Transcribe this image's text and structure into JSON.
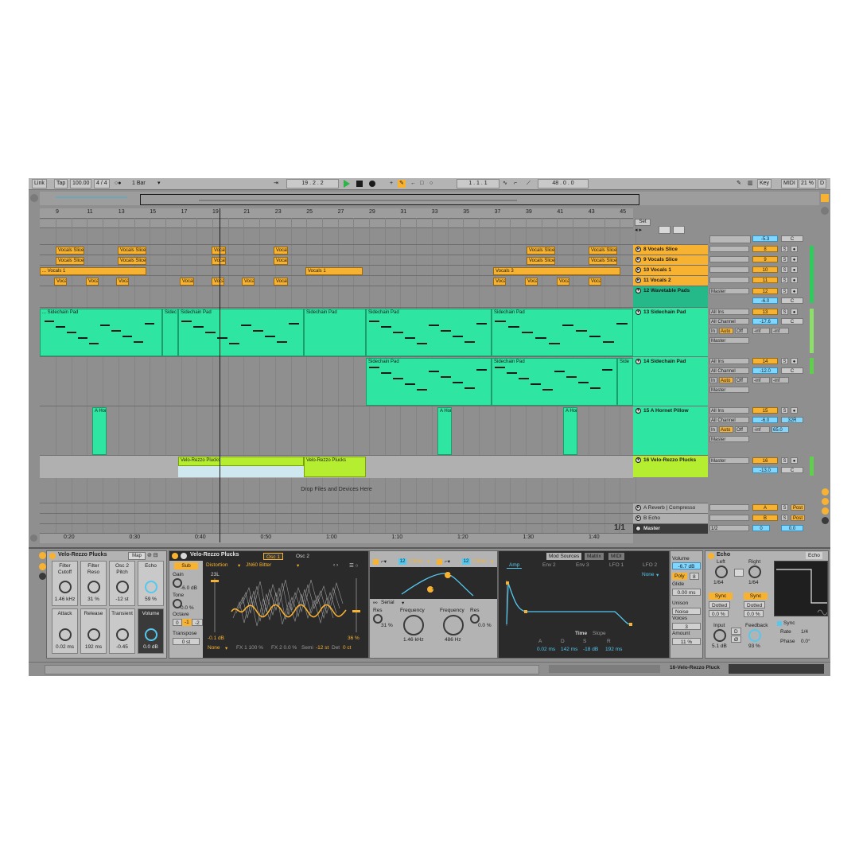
{
  "transport": {
    "link": "Link",
    "tap": "Tap",
    "tempo": "100.00",
    "time_sig": "4 / 4",
    "metronome": "○●",
    "quantize": "1 Bar",
    "position": "19 .  2 .  2",
    "loop_start": "1 .  1 .  1",
    "loop_length": "48 .  0 .  0",
    "key": "Key",
    "midi": "MIDI",
    "cpu": "21 %",
    "d": "D"
  },
  "ruler": [
    "9",
    "11",
    "13",
    "15",
    "17",
    "19",
    "21",
    "23",
    "25",
    "27",
    "29",
    "31",
    "33",
    "35",
    "37",
    "39",
    "41",
    "43",
    "45"
  ],
  "time_ruler": [
    "0:20",
    "0:30",
    "0:40",
    "0:50",
    "1:00",
    "1:10",
    "1:20",
    "1:30",
    "1:40"
  ],
  "set_label": "Set",
  "clips": {
    "vocals_slice": "Vocals Slice",
    "vocal": "Vocal",
    "voca": "Voca",
    "vocals_1_cont": "... Vocals 1",
    "vocals_1": "Vocals 1",
    "vocals_3": "Vocals 3",
    "sidechain_pad": "Sidechain Pad",
    "sidechain_pad_cont": "... Sidechain Pad",
    "sidec": "Sidec",
    "side": "Side",
    "a_hor": "A Hor",
    "velo_rezzo": "Velo-Rezzo Plucks"
  },
  "drop_text": "Drop Files and Devices Here",
  "page_indicator": "1/1",
  "tracks": [
    {
      "name": "8 Vocals Slice",
      "num": "8",
      "color": "#f8b232"
    },
    {
      "name": "9 Vocals Slice",
      "num": "9",
      "color": "#f8b232"
    },
    {
      "name": "10 Vocals 1",
      "num": "10",
      "color": "#f8b232"
    },
    {
      "name": "11 Vocals 2",
      "num": "11",
      "color": "#f8b232"
    },
    {
      "name": "12 Wavetable Pads",
      "num": "12",
      "color": "#2ee6a2",
      "vol": "-6.0",
      "out": "Master"
    },
    {
      "name": "13 Sidechain Pad",
      "num": "13",
      "color": "#2ee6a2",
      "vol": "-17.6",
      "in1": "All Ins",
      "in2": "All Channel",
      "out": "Master"
    },
    {
      "name": "14 Sidechain Pad",
      "num": "14",
      "color": "#2ee6a2",
      "vol": "-12.0",
      "in1": "All Ins",
      "in2": "All Channel",
      "out": "Master"
    },
    {
      "name": "15 A Hornet Pillow",
      "num": "15",
      "color": "#2ee6a2",
      "vol": "-6.0",
      "in1": "All Ins",
      "in2": "All Channel",
      "out": "Master",
      "pan": "32R",
      "send": "65.0"
    },
    {
      "name": "16 Velo-Rezzo Plucks",
      "num": "16",
      "color": "#b5ee30",
      "vol": "-13.0",
      "out": "Master"
    }
  ],
  "top_vol": "-5.3",
  "monitor": {
    "in": "In",
    "auto": "Auto",
    "off": "Off",
    "inf": "-inf"
  },
  "returns": [
    {
      "name": "A Reverb | Compresso",
      "letter": "A",
      "post": "Post"
    },
    {
      "name": "B Echo",
      "letter": "B",
      "post": "Post"
    }
  ],
  "master": {
    "name": "Master",
    "quant": "1/2",
    "vol": "0",
    "vol2": "0.0"
  },
  "labels": {
    "s": "S",
    "c": "C",
    "master_out": "Master"
  },
  "rack": {
    "title": "Velo-Rezzo Plucks",
    "map": "Map",
    "macros": [
      {
        "name": "Filter Cutoff",
        "value": "1.46 kHz"
      },
      {
        "name": "Filter Reso",
        "value": "31 %"
      },
      {
        "name": "Osc 2 Pitch",
        "value": "-12 st"
      },
      {
        "name": "Echo",
        "value": "59 %"
      },
      {
        "name": "Attack",
        "value": "0.02 ms"
      },
      {
        "name": "Release",
        "value": "192 ms"
      },
      {
        "name": "Transient",
        "value": "-0.45"
      },
      {
        "name": "Volume",
        "value": "0.0 dB"
      }
    ]
  },
  "synth": {
    "title": "Velo-Rezzo Plucks",
    "tab_osc1": "Osc 1",
    "tab_osc2": "Osc 2",
    "sub": "Sub",
    "gain": "Gain",
    "gain_val": "-6.0 dB",
    "tone": "Tone",
    "tone_val": "0.0 %",
    "octave": "Octave",
    "oct0": "0",
    "octm1": "-1",
    "octm2": "-2",
    "transpose": "Transpose",
    "transpose_val": "0 st",
    "dist": "Distortion",
    "wavetable": "JN60 Bitter",
    "wt_pos": "23L",
    "db": "-0.1 dB",
    "pct": "36 %",
    "none": "None",
    "fx1": "FX 1 100 %",
    "fx2": "FX 2 0.0 %",
    "semi_lbl": "Semi",
    "semi": "-12 st",
    "det_lbl": "Det",
    "det": "0 ct",
    "filt_num1": "12",
    "filt_num2": "12",
    "clean1": "Clean",
    "clean2": "Clean",
    "serial": "Serial",
    "res1": "Res",
    "res1_val": "31 %",
    "freq1": "Frequency",
    "freq1_val": "1.46 kHz",
    "freq2": "Frequency",
    "freq2_val": "486 Hz",
    "res2": "Res",
    "res2_val": "0.0 %",
    "mod_sources": "Mod Sources",
    "matrix": "Matrix",
    "midi": "MIDI",
    "amp": "Amp",
    "env2": "Env 2",
    "env3": "Env 3",
    "lfo1": "LFO 1",
    "lfo2": "LFO 2",
    "none2": "None",
    "time": "Time",
    "slope": "Slope",
    "a": "A",
    "d": "D",
    "s": "S",
    "r": "R",
    "a_val": "0.02 ms",
    "d_val": "142 ms",
    "s_val": "-18 dB",
    "r_val": "192 ms",
    "volume": "Volume",
    "volume_val": "-6.7 dB",
    "poly": "Poly",
    "voices_n": "8",
    "glide": "Glide",
    "glide_val": "0.00 ms",
    "unison": "Unison",
    "unison_val": "Noise",
    "voices": "Voices",
    "voices_val": "3",
    "amount": "Amount",
    "amount_val": "11 %"
  },
  "echo": {
    "title": "Echo",
    "tab": "Echo",
    "left": "Left",
    "right": "Right",
    "left_val": "1/64",
    "right_val": "1/64",
    "sync": "Sync",
    "dotted": "Dotted",
    "pct": "0.0 %",
    "input": "Input",
    "input_val": "5.1 dB",
    "feedback": "Feedback",
    "feedback_val": "93 %",
    "d": "D",
    "sync2": "Sync",
    "rate": "Rate",
    "rate_val": "1/4",
    "phase": "Phase",
    "phase_val": "0.0°"
  },
  "status": {
    "track": "16-Velo-Rezzo Pluck"
  },
  "colors": {
    "orange": "#f8b232",
    "green": "#2ee6a2",
    "lime": "#b5ee30",
    "blue": "#7fd6ff"
  }
}
